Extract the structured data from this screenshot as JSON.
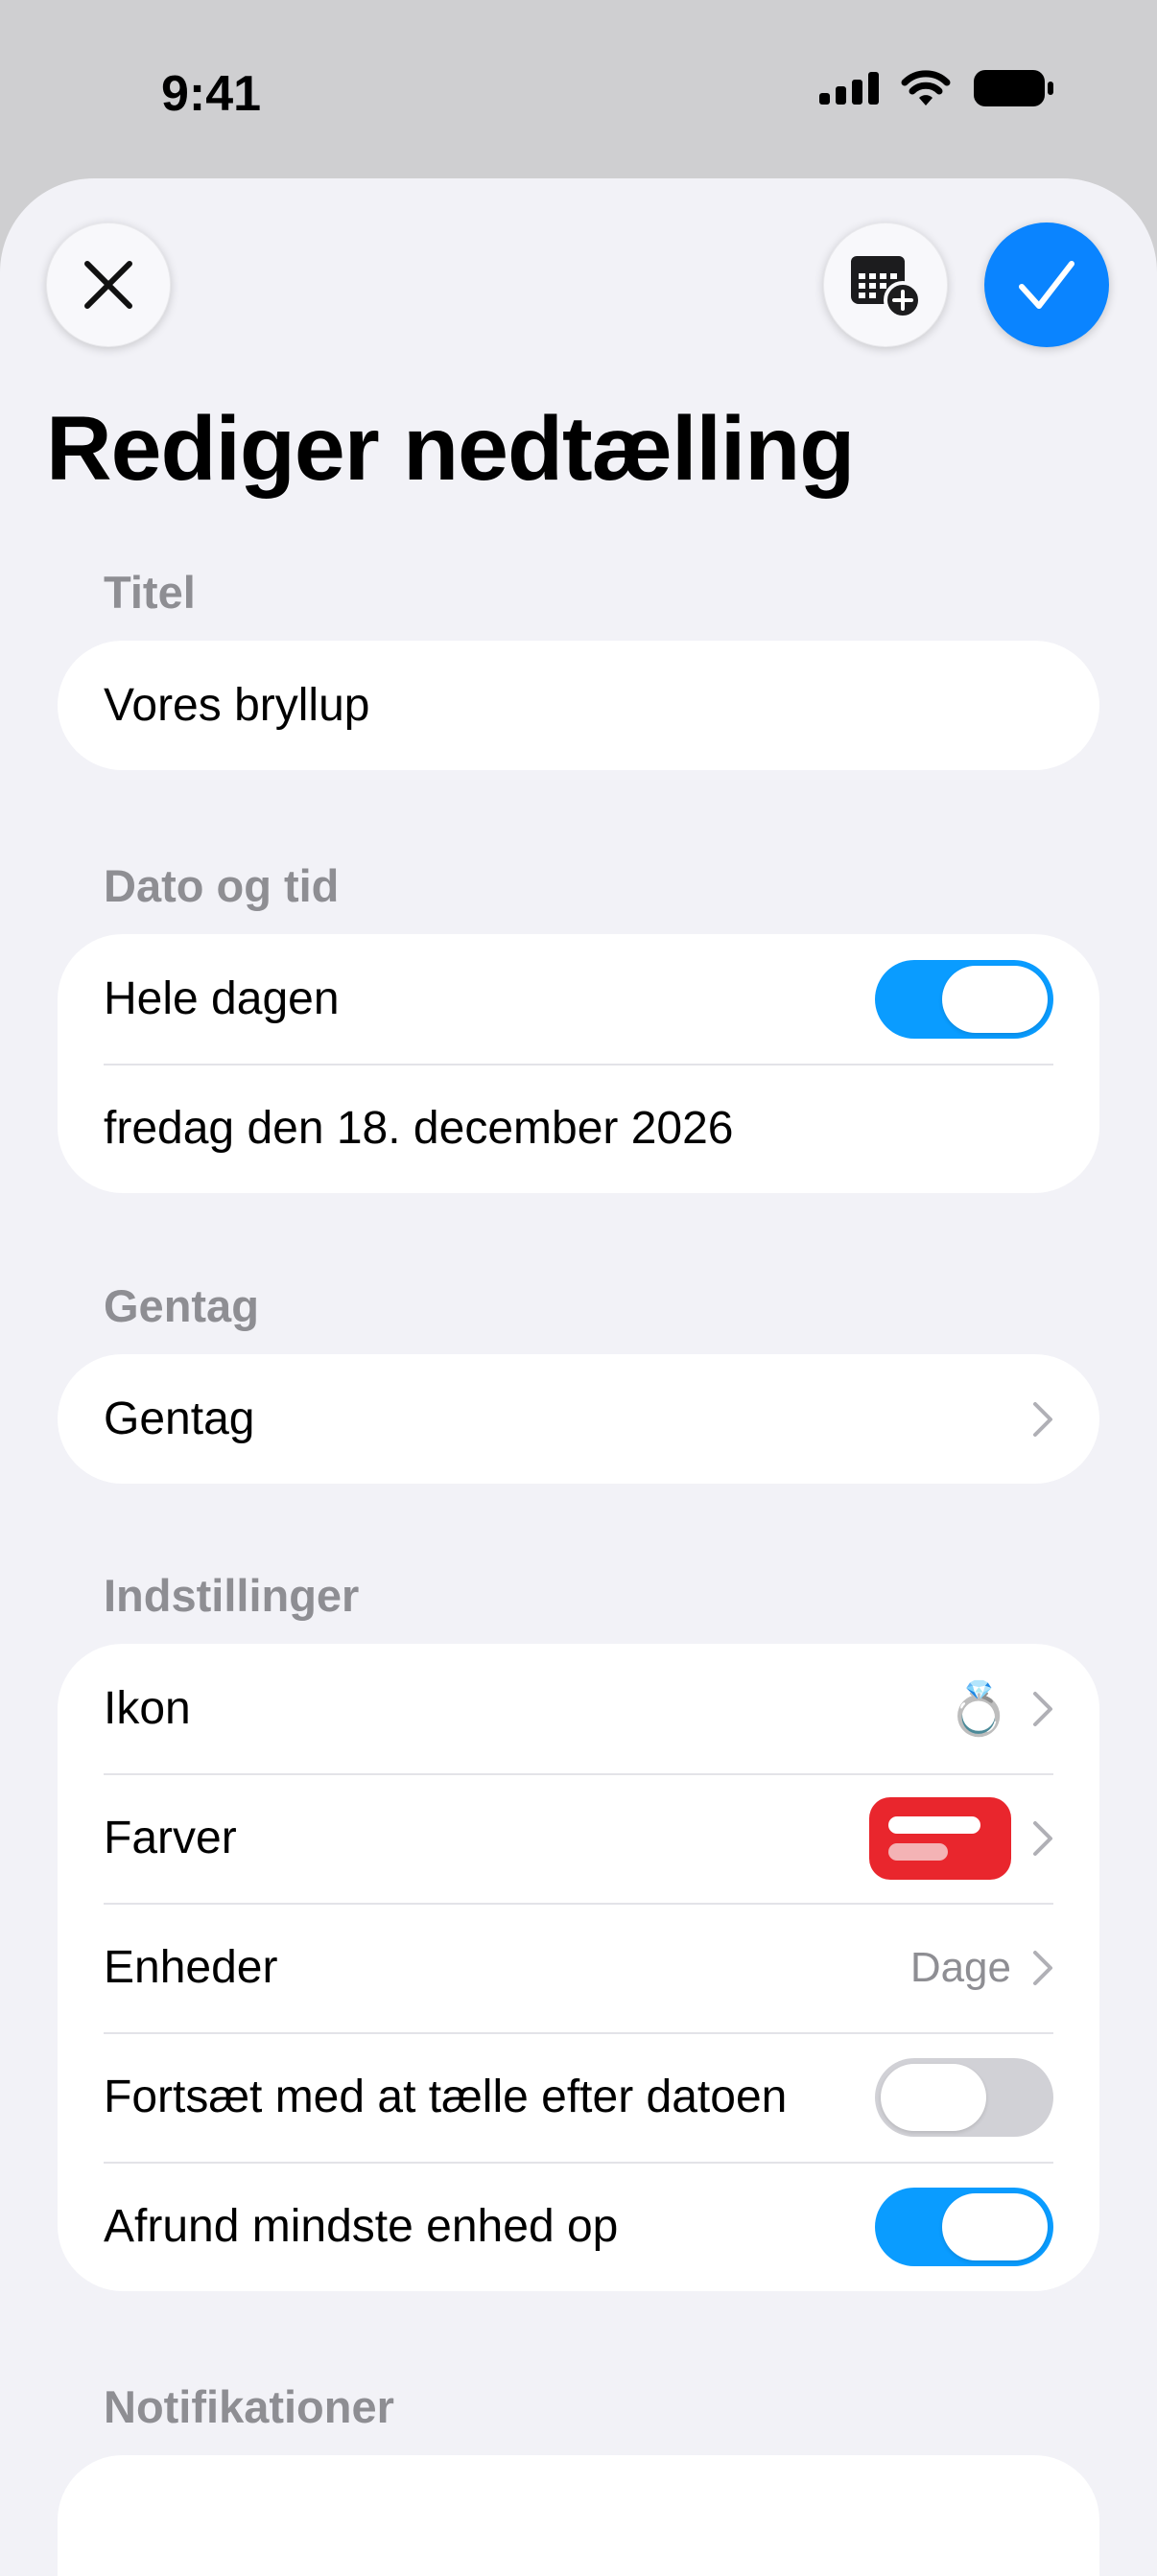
{
  "status_bar": {
    "time": "9:41"
  },
  "header": {
    "title": "Rediger nedtælling",
    "accent_color": "#0a84ff"
  },
  "sections": {
    "title": {
      "label": "Titel",
      "value": "Vores bryllup"
    },
    "date_time": {
      "label": "Dato og tid",
      "all_day_label": "Hele dagen",
      "all_day_on": true,
      "date_value": "fredag den 18. december 2026"
    },
    "repeat": {
      "label": "Gentag",
      "row_label": "Gentag"
    },
    "settings": {
      "label": "Indstillinger",
      "icon_label": "Ikon",
      "icon_value": "💍",
      "colors_label": "Farver",
      "color_value": "#e9262d",
      "units_label": "Enheder",
      "units_value": "Dage",
      "continue_label": "Fortsæt med at tælle efter datoen",
      "continue_on": false,
      "round_label": "Afrund mindste enhed op",
      "round_on": true
    },
    "notifications": {
      "label": "Notifikationer"
    }
  }
}
